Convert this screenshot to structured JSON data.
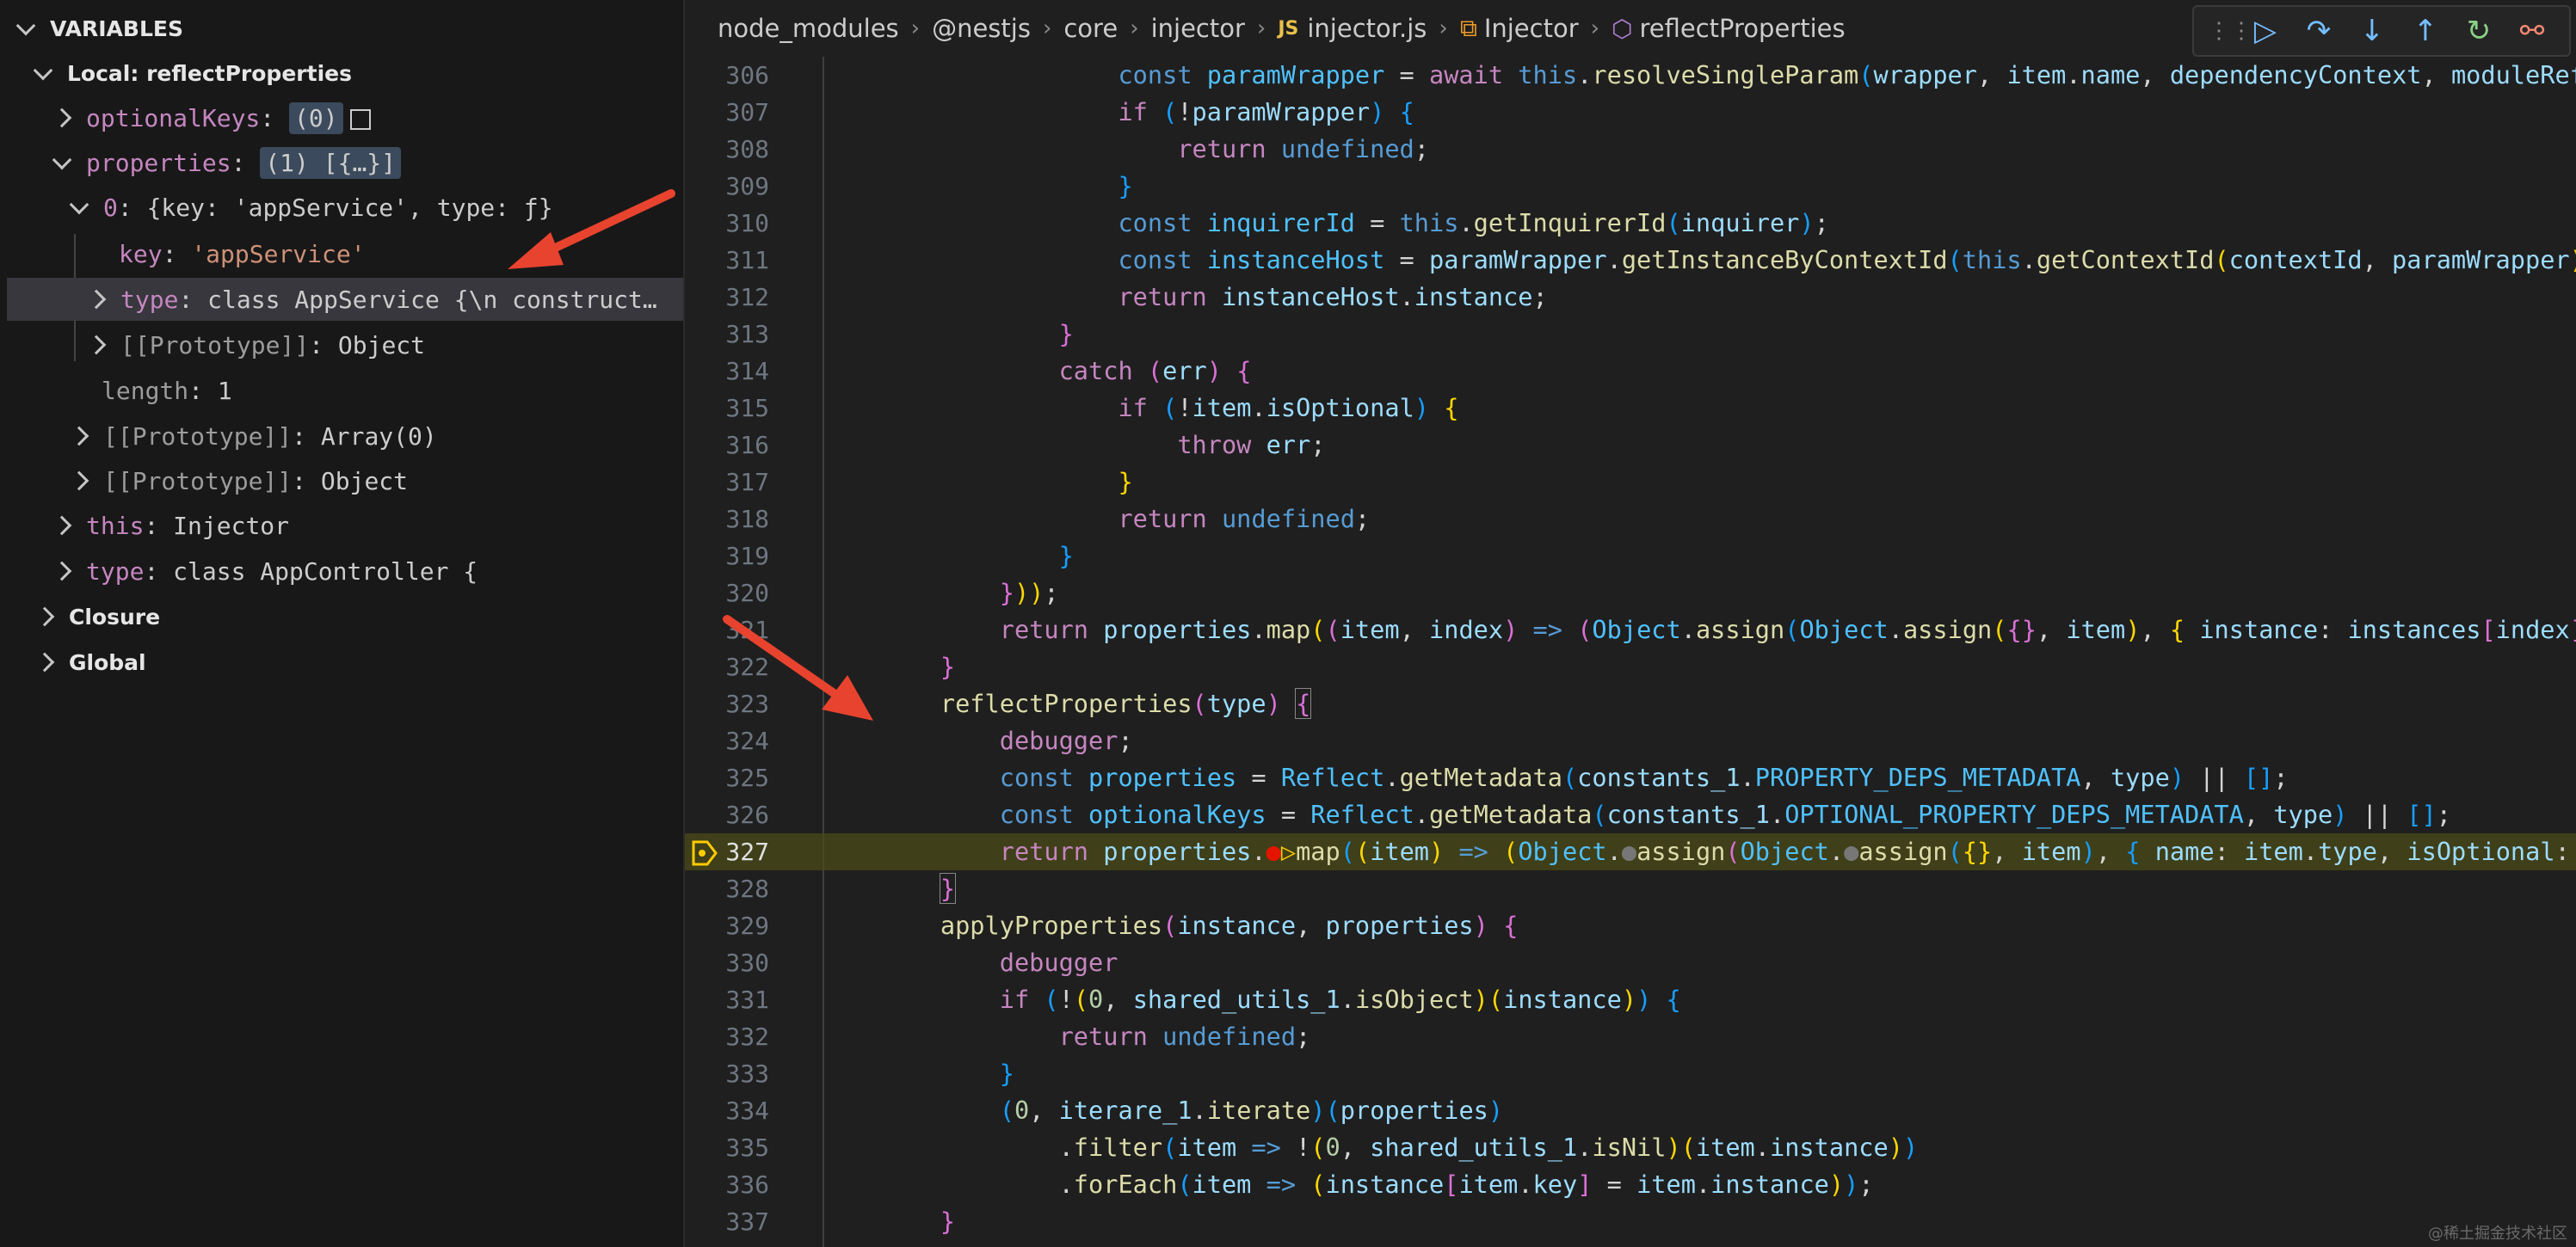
{
  "variables_panel": {
    "title": "VARIABLES",
    "scope_local": "Local: reflectProperties",
    "rows": {
      "optional_keys": {
        "name": "optionalKeys",
        "sep": ":",
        "value": "(0)"
      },
      "properties": {
        "name": "properties",
        "sep": ":",
        "value": "(1) [{…}]"
      },
      "item0": {
        "name": "0",
        "sep": ":",
        "value": "{key: 'appService', type: ƒ}"
      },
      "key": {
        "name": "key",
        "sep": ":",
        "value": "'appService'"
      },
      "type_item": {
        "name": "type",
        "sep": ":",
        "value": "class AppService {\\n     construct…"
      },
      "proto_item": {
        "name": "[[Prototype]]",
        "sep": ":",
        "value": "Object"
      },
      "length": {
        "name": "length",
        "sep": ":",
        "value": "1"
      },
      "proto_array": {
        "name": "[[Prototype]]",
        "sep": ":",
        "value": "Array(0)"
      },
      "proto_props": {
        "name": "[[Prototype]]",
        "sep": ":",
        "value": "Object"
      },
      "this_row": {
        "name": "this",
        "sep": ":",
        "value": "Injector"
      },
      "type_row": {
        "name": "type",
        "sep": ":",
        "value": "class AppController {"
      }
    },
    "scope_closure": "Closure",
    "scope_global": "Global"
  },
  "breadcrumb": {
    "parts": [
      "node_modules",
      "@nestjs",
      "core",
      "injector",
      "injector.js",
      "Injector",
      "reflectProperties"
    ],
    "js_badge": "JS"
  },
  "debug_toolbar": {
    "grip": "⋮⋮",
    "continue": "▷",
    "step_over": "↷",
    "step_into": "↓",
    "step_out": "↑",
    "restart": "↻",
    "disconnect": "⚯"
  },
  "editor": {
    "current_line": 327,
    "line_numbers": [
      "306",
      "307",
      "308",
      "309",
      "310",
      "311",
      "312",
      "313",
      "314",
      "315",
      "316",
      "317",
      "318",
      "319",
      "320",
      "321",
      "322",
      "323",
      "324",
      "325",
      "326",
      "327",
      "328",
      "329",
      "330",
      "331",
      "332",
      "333",
      "334",
      "335",
      "336",
      "337"
    ]
  },
  "watermark": "@稀土掘金技术社区",
  "colors": {
    "accent": "#75beff",
    "annotation_arrow": "#e8432e",
    "current_line_bg": "#4b4b18"
  }
}
